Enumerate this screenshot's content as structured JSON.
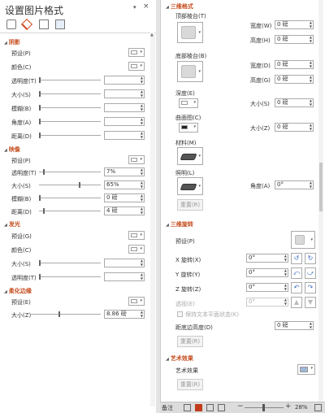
{
  "left_panel": {
    "title": "设置图片格式",
    "dropdown_glyph": "▾",
    "close_glyph": "×",
    "tabs": [
      "fill-line-icon",
      "effects-icon",
      "size-properties-icon",
      "picture-icon"
    ],
    "sections": {
      "shadow": {
        "title": "阴影",
        "preset": "预设(P)",
        "color": "颜色(C)",
        "transparency": "透明度(T)",
        "size": "大小(S)",
        "blur": "模糊(B)",
        "angle": "角度(A)",
        "distance": "距离(D)"
      },
      "reflection": {
        "title": "映像",
        "preset": "预设(P)",
        "transparency": "透明度(T)",
        "transparency_value": "7%",
        "transparency_level": 7,
        "size": "大小(S)",
        "size_value": "65%",
        "size_level": 65,
        "blur": "模糊(B)",
        "blur_value": "0 磅",
        "distance": "距离(D)",
        "distance_value": "4 磅"
      },
      "glow": {
        "title": "发光",
        "preset": "预设(G)",
        "color": "颜色(C)",
        "size": "大小(S)",
        "transparency": "透明度(T)"
      },
      "soft_edges": {
        "title": "柔化边缘",
        "preset": "预设(E)",
        "size": "大小(Z)",
        "size_value": "8.86 磅"
      }
    }
  },
  "right_panel": {
    "format_3d": {
      "title": "三维格式",
      "top_bevel": "顶部棱台(T)",
      "bottom_bevel": "底部棱台(B)",
      "width": "宽度(W)",
      "height": "高度(H)",
      "width2": "宽度(D)",
      "height2": "高度(G)",
      "value_zero": "0 磅",
      "depth": "深度(E)",
      "depth_size": "大小(S)",
      "contour": "曲面图(C)",
      "contour_size": "大小(Z)",
      "material": "材料(M)",
      "lighting": "照明(L)",
      "angle": "角度(A)",
      "angle_value": "0°",
      "reset": "重置(R)"
    },
    "rotation_3d": {
      "title": "三维旋转",
      "preset": "预设(P)",
      "x_rotation": "X 旋转(X)",
      "y_rotation": "Y 旋转(Y)",
      "z_rotation": "Z 旋转(Z)",
      "perspective": "透视(E)",
      "x_value": "0°",
      "y_value": "0°",
      "z_value": "0°",
      "p_value": "0°",
      "keep_text_flat": "保持文本平面状态(K)",
      "distance_from_ground": "距底边高度(D)",
      "distance_value": "0 磅",
      "reset": "重置(R)"
    },
    "artistic_effects": {
      "title": "艺术效果",
      "label": "艺术效果",
      "reset": "重置(R)"
    }
  },
  "status_bar": {
    "notes": "备注",
    "zoom": "28%",
    "zoom_level": 28
  }
}
